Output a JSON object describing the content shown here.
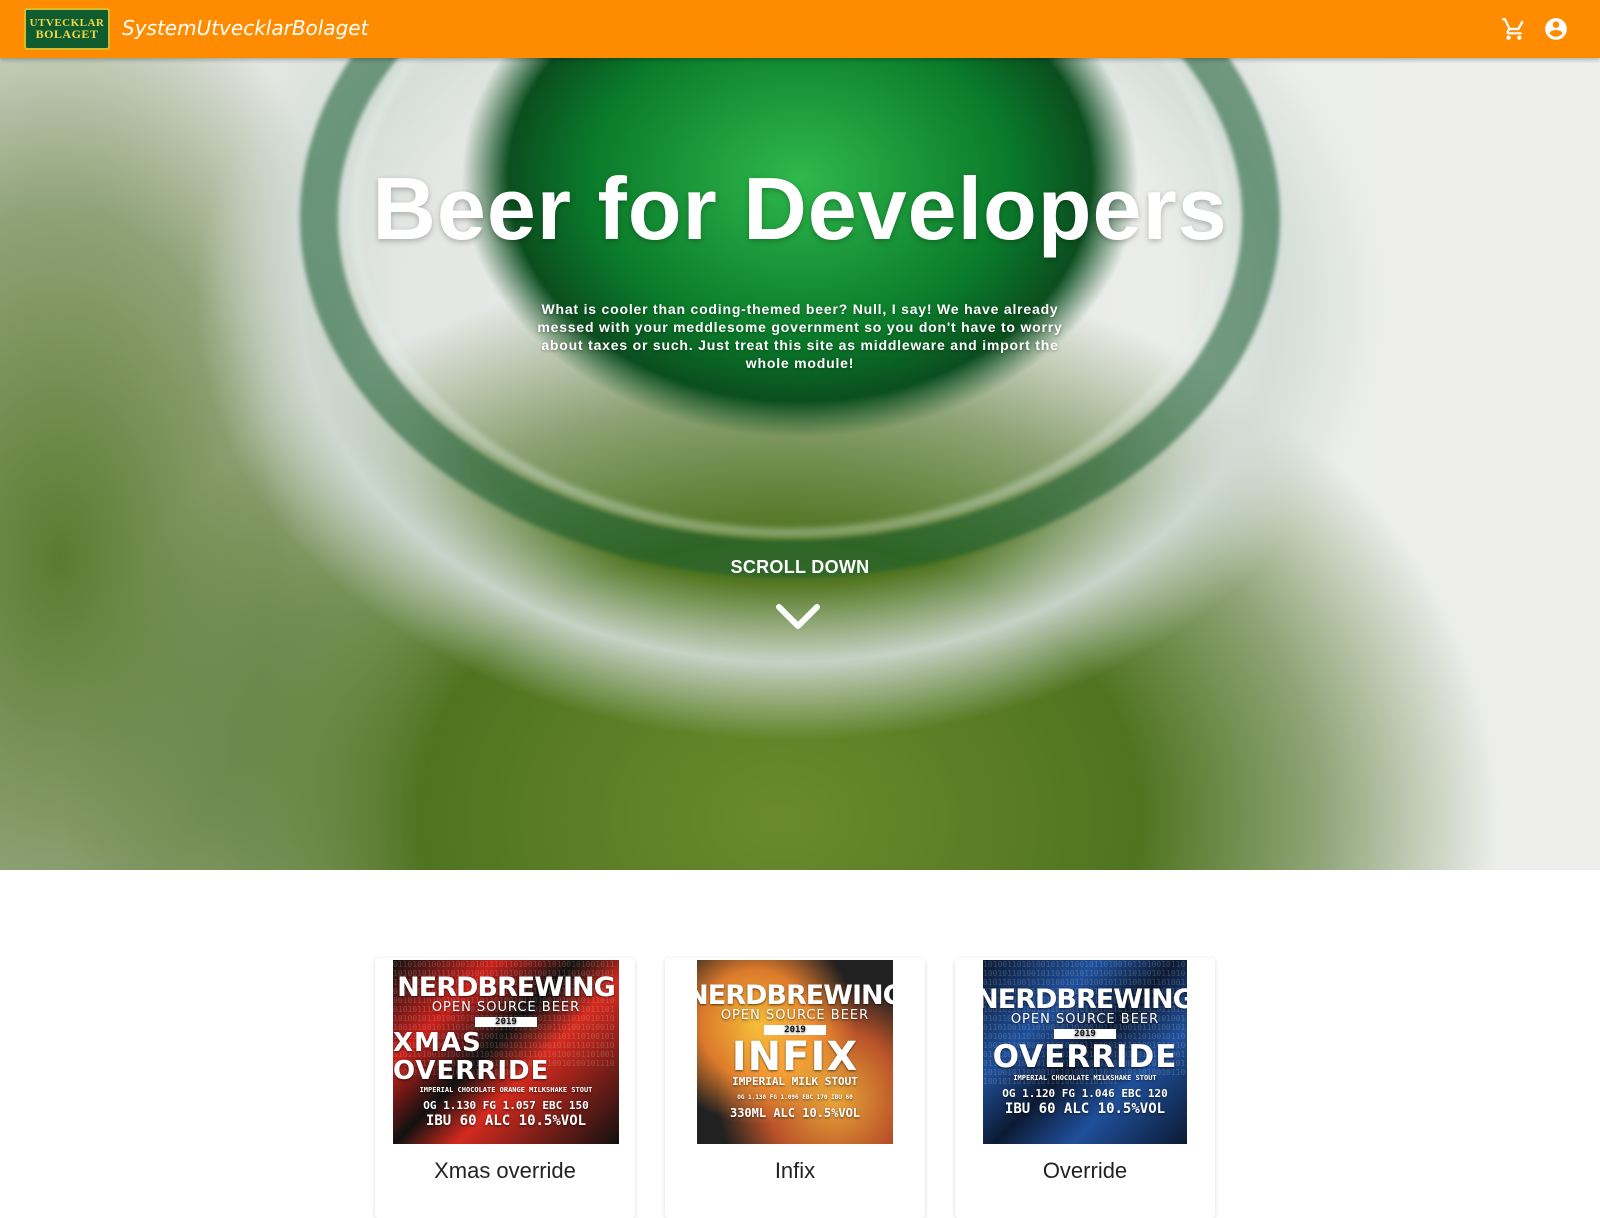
{
  "header": {
    "logo": {
      "line1": "UTVECKLAR",
      "line2": "BOLAGET"
    },
    "title": "SystemUtvecklarBolaget",
    "icons": {
      "cart": "shopping-cart-icon",
      "account": "account-circle-icon"
    },
    "colors": {
      "bar": "#ff8c00"
    }
  },
  "hero": {
    "title": "Beer for Developers",
    "description": "What is cooler than coding-themed beer? Null, I say! We have already messed with your meddlesome government so you don't have to worry about taxes or such. Just treat this site as middleware and import the whole module!",
    "scroll_label": "SCROLL DOWN",
    "scroll_icon": "chevron-down-icon"
  },
  "products": [
    {
      "name": "Xmas override",
      "image": {
        "brand": "NERDBREWING",
        "sub": "OPEN SOURCE BEER",
        "year": "2019",
        "beer": "XMAS OVERRIDE",
        "style": "IMPERIAL CHOCOLATE ORANGE MILKSHAKE STOUT",
        "stats": "OG 1.130 FG 1.057 EBC 150",
        "stats2": "IBU 60 ALC 10.5%VOL",
        "bg": "#c8201a"
      }
    },
    {
      "name": "Infix",
      "image": {
        "brand": "NERDBREWING",
        "sub": "OPEN SOURCE BEER",
        "year": "2019",
        "beer": "INFIX",
        "style": "IMPERIAL MILK STOUT",
        "stats": "OG 1.130 FG 1.096 EBC 170 IBU 60",
        "stats2": "330ML ALC 10.5%VOL",
        "bg": "#d98a1c"
      }
    },
    {
      "name": "Override",
      "image": {
        "brand": "NERDBREWING",
        "sub": "OPEN SOURCE BEER",
        "year": "2019",
        "beer": "OVERRIDE",
        "style": "IMPERIAL CHOCOLATE MILKSHAKE STOUT",
        "stats": "OG 1.120 FG 1.046 EBC 120",
        "stats2": "IBU 60 ALC 10.5%VOL",
        "bg": "#1f4f9a"
      }
    }
  ]
}
